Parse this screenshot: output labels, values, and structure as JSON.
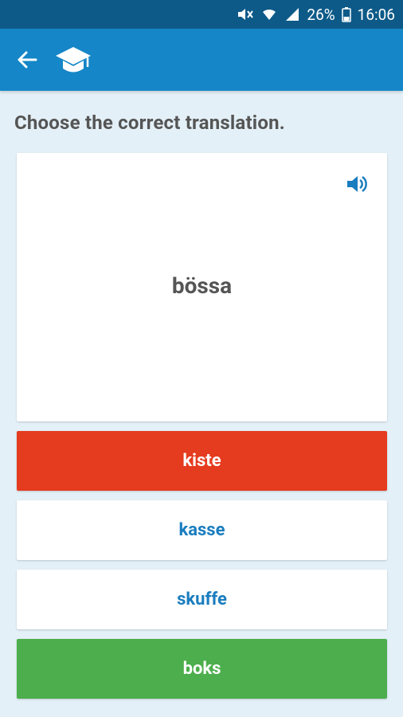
{
  "status_bar": {
    "battery": "26%",
    "time": "16:06",
    "icons": [
      "mute-icon",
      "wifi-icon",
      "signal-icon",
      "battery-icon"
    ]
  },
  "app_bar": {
    "icons": [
      "back-arrow-icon",
      "graduation-cap-icon"
    ]
  },
  "quiz": {
    "prompt": "Choose the correct translation.",
    "word": "bössa",
    "options": [
      {
        "label": "kiste",
        "state": "wrong"
      },
      {
        "label": "kasse",
        "state": "neutral"
      },
      {
        "label": "skuffe",
        "state": "neutral"
      },
      {
        "label": "boks",
        "state": "correct"
      }
    ]
  },
  "colors": {
    "status_bar": "#0d5a88",
    "app_bar": "#1586c7",
    "background": "#e4f0f7",
    "wrong": "#e53b1f",
    "correct": "#4cae4c",
    "option_text": "#1a7dbf"
  }
}
